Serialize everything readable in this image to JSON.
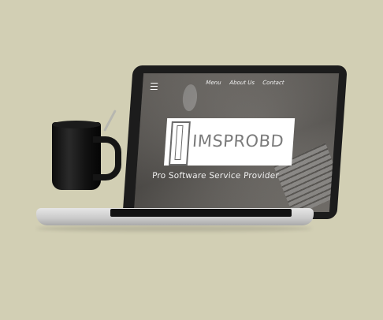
{
  "nav": {
    "items": [
      "Menu",
      "About Us",
      "Contact"
    ]
  },
  "brand": {
    "name": "IMSPROBD",
    "tagline": "Pro Software Service Provider"
  },
  "colors": {
    "background": "#d2cfb4",
    "logo_box": "#ffffff",
    "logo_text": "#7b7b7b"
  },
  "icons": [
    "menu-hamburger-icon",
    "logo-mark-icon"
  ]
}
